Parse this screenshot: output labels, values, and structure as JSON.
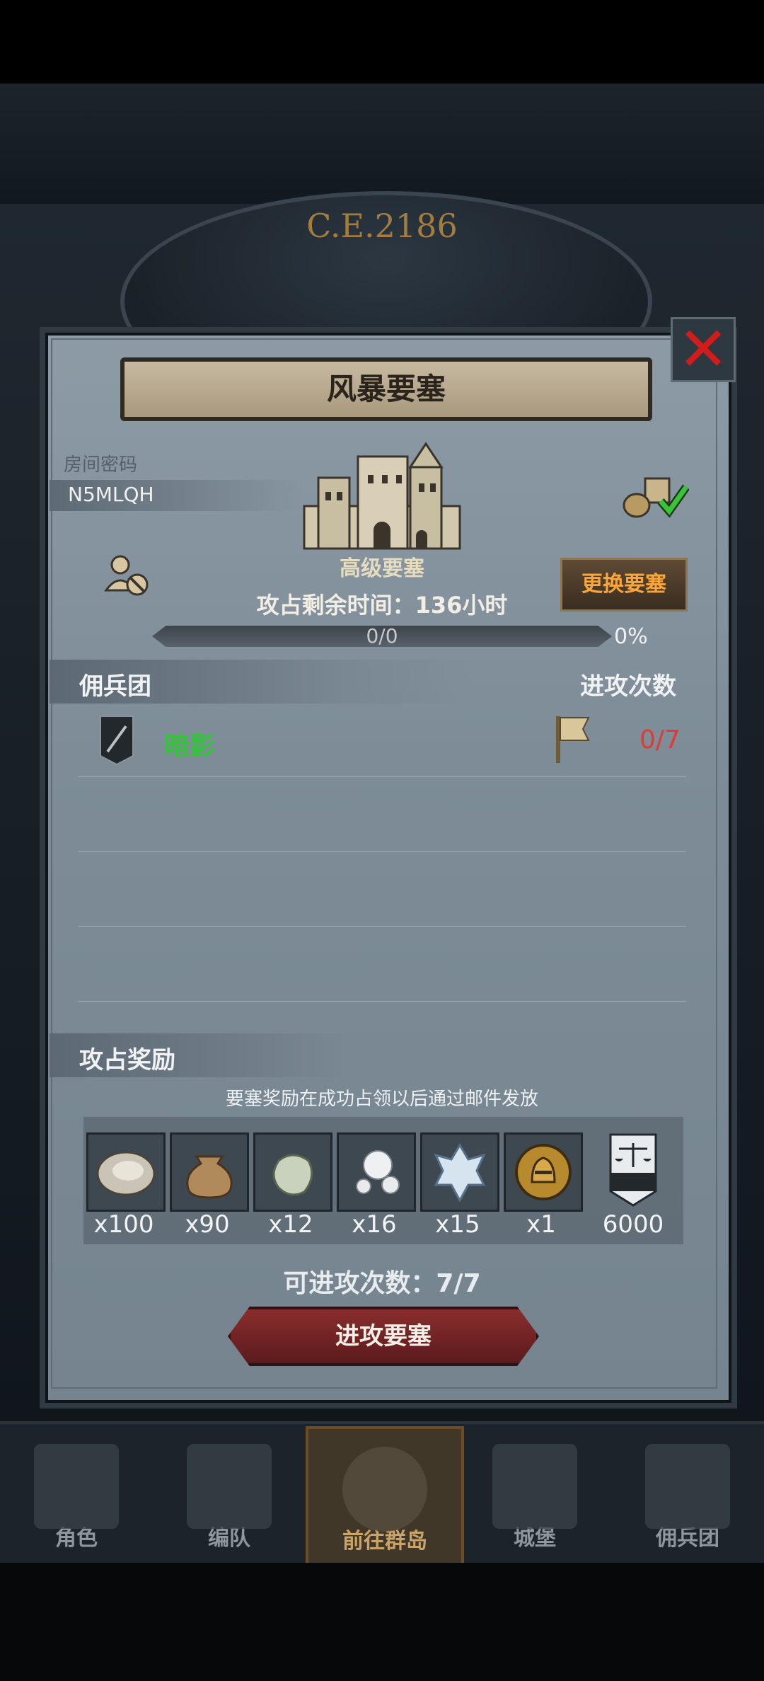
{
  "era": "C.E.2186",
  "dialog": {
    "title": "风暴要塞",
    "room_password_label": "房间密码",
    "room_password": "N5MLQH",
    "fortress_grade": "高级要塞",
    "remaining_time": "攻占剩余时间：136小时",
    "change_fortress": "更换要塞",
    "progress_text": "0/0",
    "progress_percent": "0%",
    "progress_value": 0,
    "mercenary_header": "佣兵团",
    "attacks_header": "进攻次数",
    "guilds": [
      {
        "name": "暗影",
        "attacks": "0/7"
      }
    ],
    "rewards_header": "攻占奖励",
    "rewards_note": "要塞奖励在成功占领以后通过邮件发放",
    "rewards": [
      {
        "icon": "oyster-icon",
        "qty": "x100"
      },
      {
        "icon": "sack-icon",
        "qty": "x90"
      },
      {
        "icon": "gem-stone-icon",
        "qty": "x12"
      },
      {
        "icon": "pearls-icon",
        "qty": "x16"
      },
      {
        "icon": "crystal-icon",
        "qty": "x15"
      },
      {
        "icon": "knight-medal-icon",
        "qty": "x1"
      },
      {
        "icon": "banner-scales-icon",
        "qty": "6000"
      }
    ],
    "available_attacks": "可进攻次数：7/7",
    "attack_button": "进攻要塞"
  },
  "nav": [
    {
      "label": "角色",
      "icon": "knight-icon"
    },
    {
      "label": "编队",
      "icon": "helmet-icon"
    },
    {
      "label": "前往群岛",
      "icon": "compass-icon",
      "active": true
    },
    {
      "label": "城堡",
      "icon": "castle-icon"
    },
    {
      "label": "佣兵团",
      "icon": "ship-icon"
    }
  ]
}
